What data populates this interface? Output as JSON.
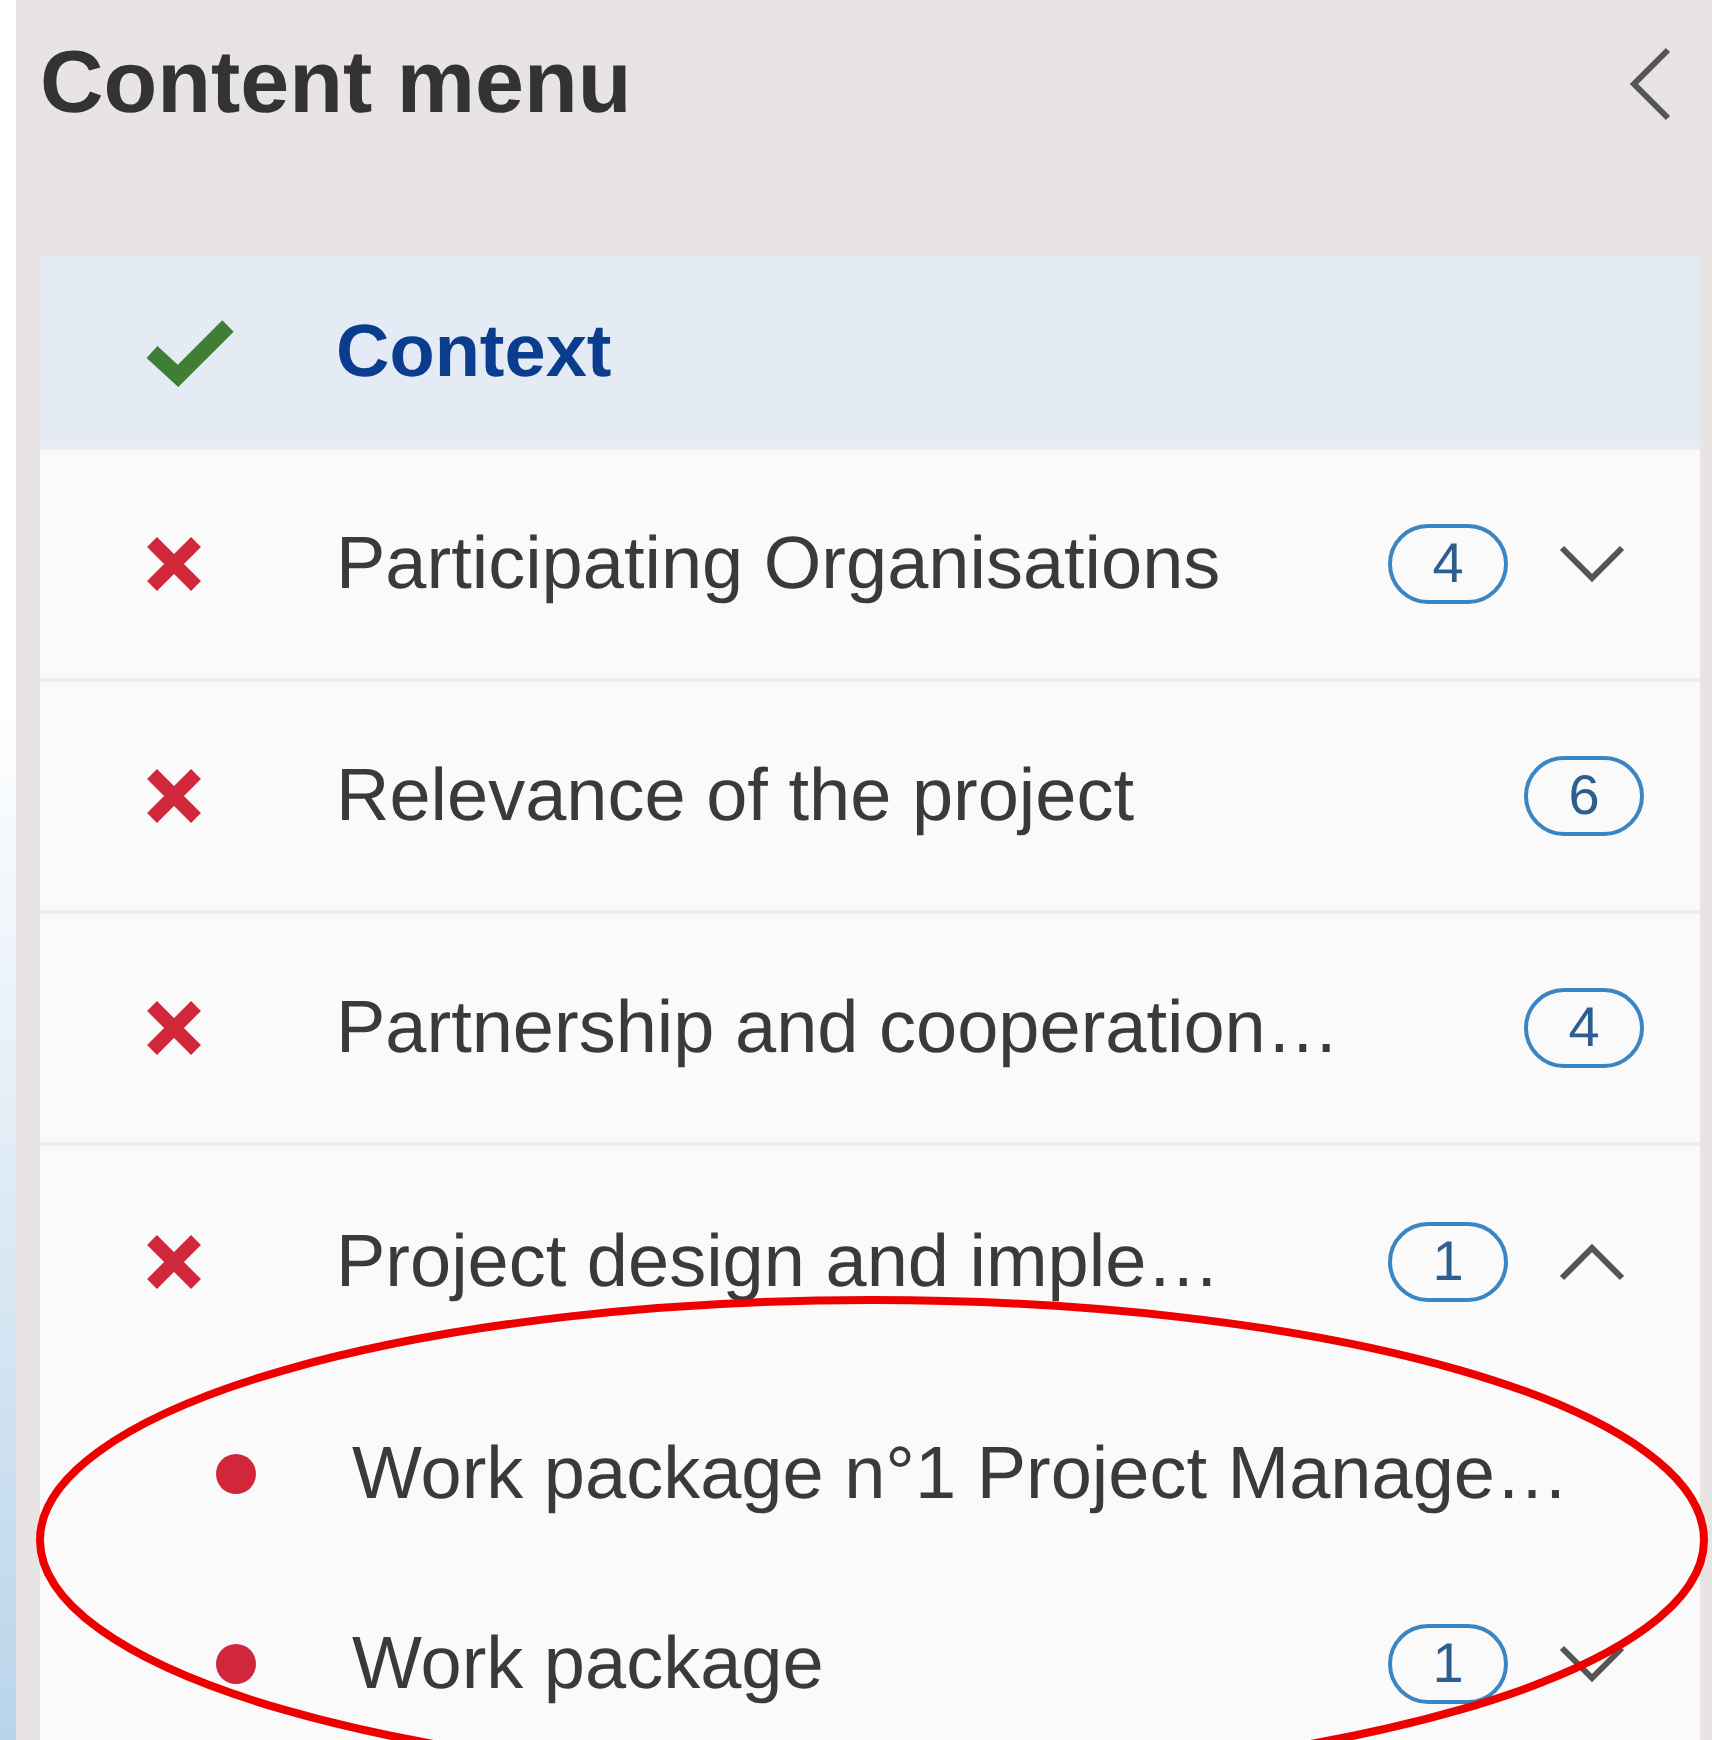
{
  "panel": {
    "title": "Content menu"
  },
  "sections": [
    {
      "label": "Context",
      "kind": "done",
      "selected": true
    },
    {
      "label": "Participating Organisations",
      "kind": "error",
      "selected": false,
      "count": "4",
      "expanded": false
    },
    {
      "label": "Relevance of the project",
      "kind": "error",
      "selected": false,
      "count": "6"
    },
    {
      "label": "Partnership and cooperation…",
      "kind": "error",
      "selected": false,
      "count": "4"
    },
    {
      "label": "Project design and imple…",
      "kind": "error",
      "selected": false,
      "count": "1",
      "expanded": true,
      "children": [
        {
          "label": "Work package n°1 Project Manage…",
          "kind": "error"
        },
        {
          "label": "Work package",
          "kind": "error",
          "count": "1",
          "expanded": false
        }
      ]
    }
  ]
}
